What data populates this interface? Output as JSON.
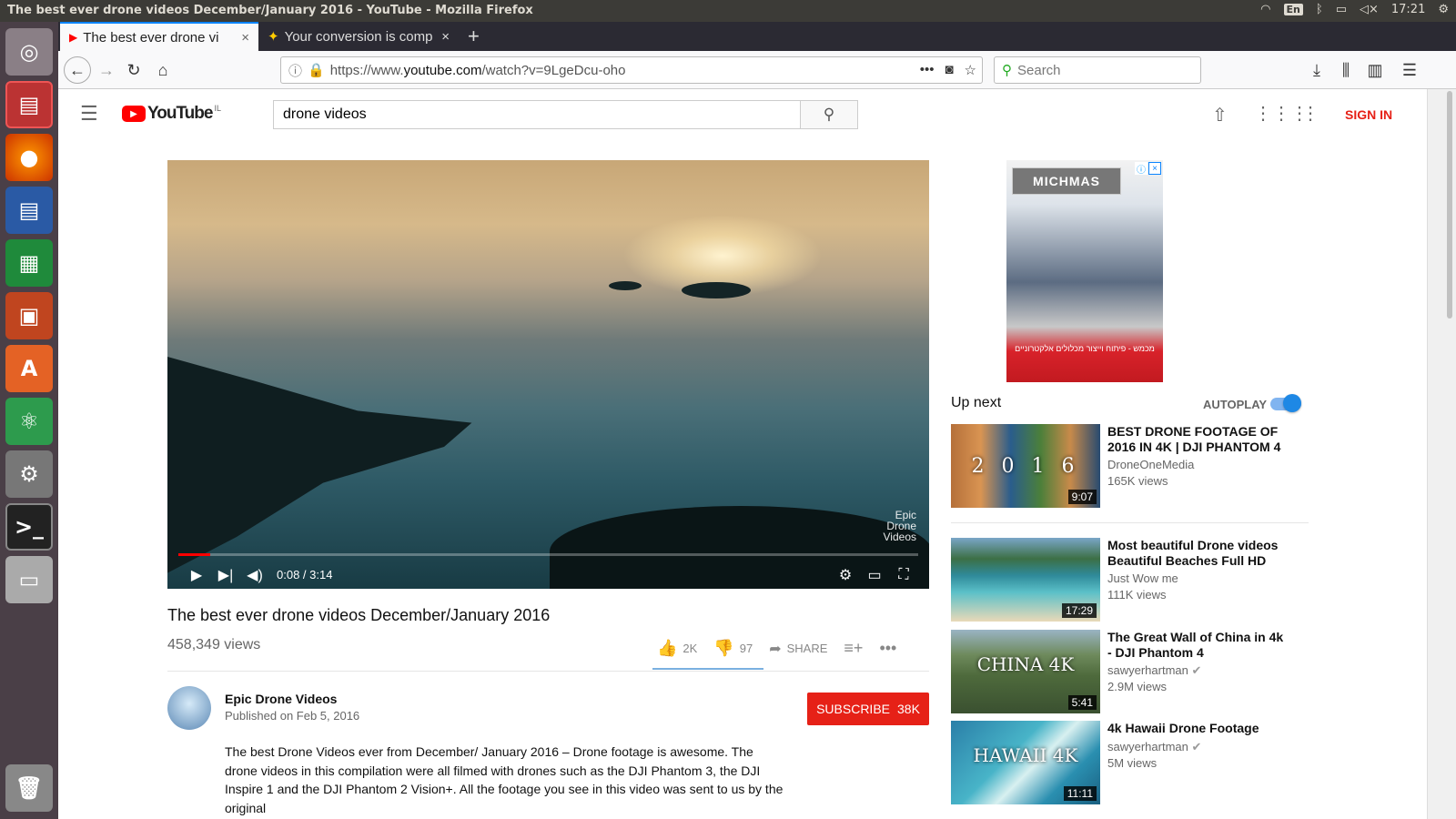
{
  "os": {
    "window_title": "The best ever drone videos December/January 2016 - YouTube - Mozilla Firefox",
    "keyboard": "En",
    "clock": "17:21"
  },
  "browser": {
    "tabs": [
      {
        "label": "The best ever drone vi",
        "close": "×"
      },
      {
        "label": "Your conversion is comp",
        "close": "×"
      }
    ],
    "new_tab": "+",
    "url_prefix": "https://www.",
    "url_host": "youtube.com",
    "url_path": "/watch?v=9LgeDcu-oho",
    "search_placeholder": "Search"
  },
  "youtube": {
    "logo_text": "YouTube",
    "logo_region": "IL",
    "search_value": "drone videos",
    "sign_in": "SIGN IN",
    "player": {
      "time": "0:08 / 3:14",
      "progress_fraction": 0.043,
      "watermark_line1": "Epic",
      "watermark_line2": "Drone",
      "watermark_line3": "Videos"
    },
    "video_title": "The best ever drone videos December/January 2016",
    "views": "458,349 views",
    "likes": "2K",
    "dislikes": "97",
    "share": "SHARE",
    "channel_name": "Epic Drone Videos",
    "published": "Published on Feb 5, 2016",
    "subscribe_label": "SUBSCRIBE",
    "subscribe_count": "38K",
    "description": "The best Drone Videos ever from December/ January 2016 – Drone footage is awesome. The drone videos in this compilation were all filmed with drones such as the DJI Phantom 3, the DJI Inspire 1 and the DJI Phantom 2 Vision+. All the footage you see in this video was sent to us by the original",
    "ad": {
      "logo": "MICHMAS",
      "text": "מכמש - פיתוח וייצור מכלולים אלקטרוניים"
    },
    "up_next": "Up next",
    "autoplay": "AUTOPLAY",
    "autoplay_on": true,
    "recommendations": [
      {
        "title": "BEST DRONE FOOTAGE OF 2016 IN 4K | DJI PHANTOM 4",
        "channel": "DroneOneMedia",
        "views": "165K views",
        "duration": "9:07",
        "overlay": "2 0 1 6",
        "verified": false
      },
      {
        "title": "Most beautiful Drone videos Beautiful Beaches Full HD",
        "channel": "Just Wow me",
        "views": "111K views",
        "duration": "17:29",
        "overlay": "",
        "verified": false
      },
      {
        "title": "The Great Wall of China in 4k - DJI Phantom 4",
        "channel": "sawyerhartman",
        "views": "2.9M views",
        "duration": "5:41",
        "overlay": "CHINA 4K",
        "verified": true
      },
      {
        "title": "4k Hawaii Drone Footage",
        "channel": "sawyerhartman",
        "views": "5M views",
        "duration": "11:11",
        "overlay": "HAWAII 4K",
        "verified": true
      }
    ]
  }
}
